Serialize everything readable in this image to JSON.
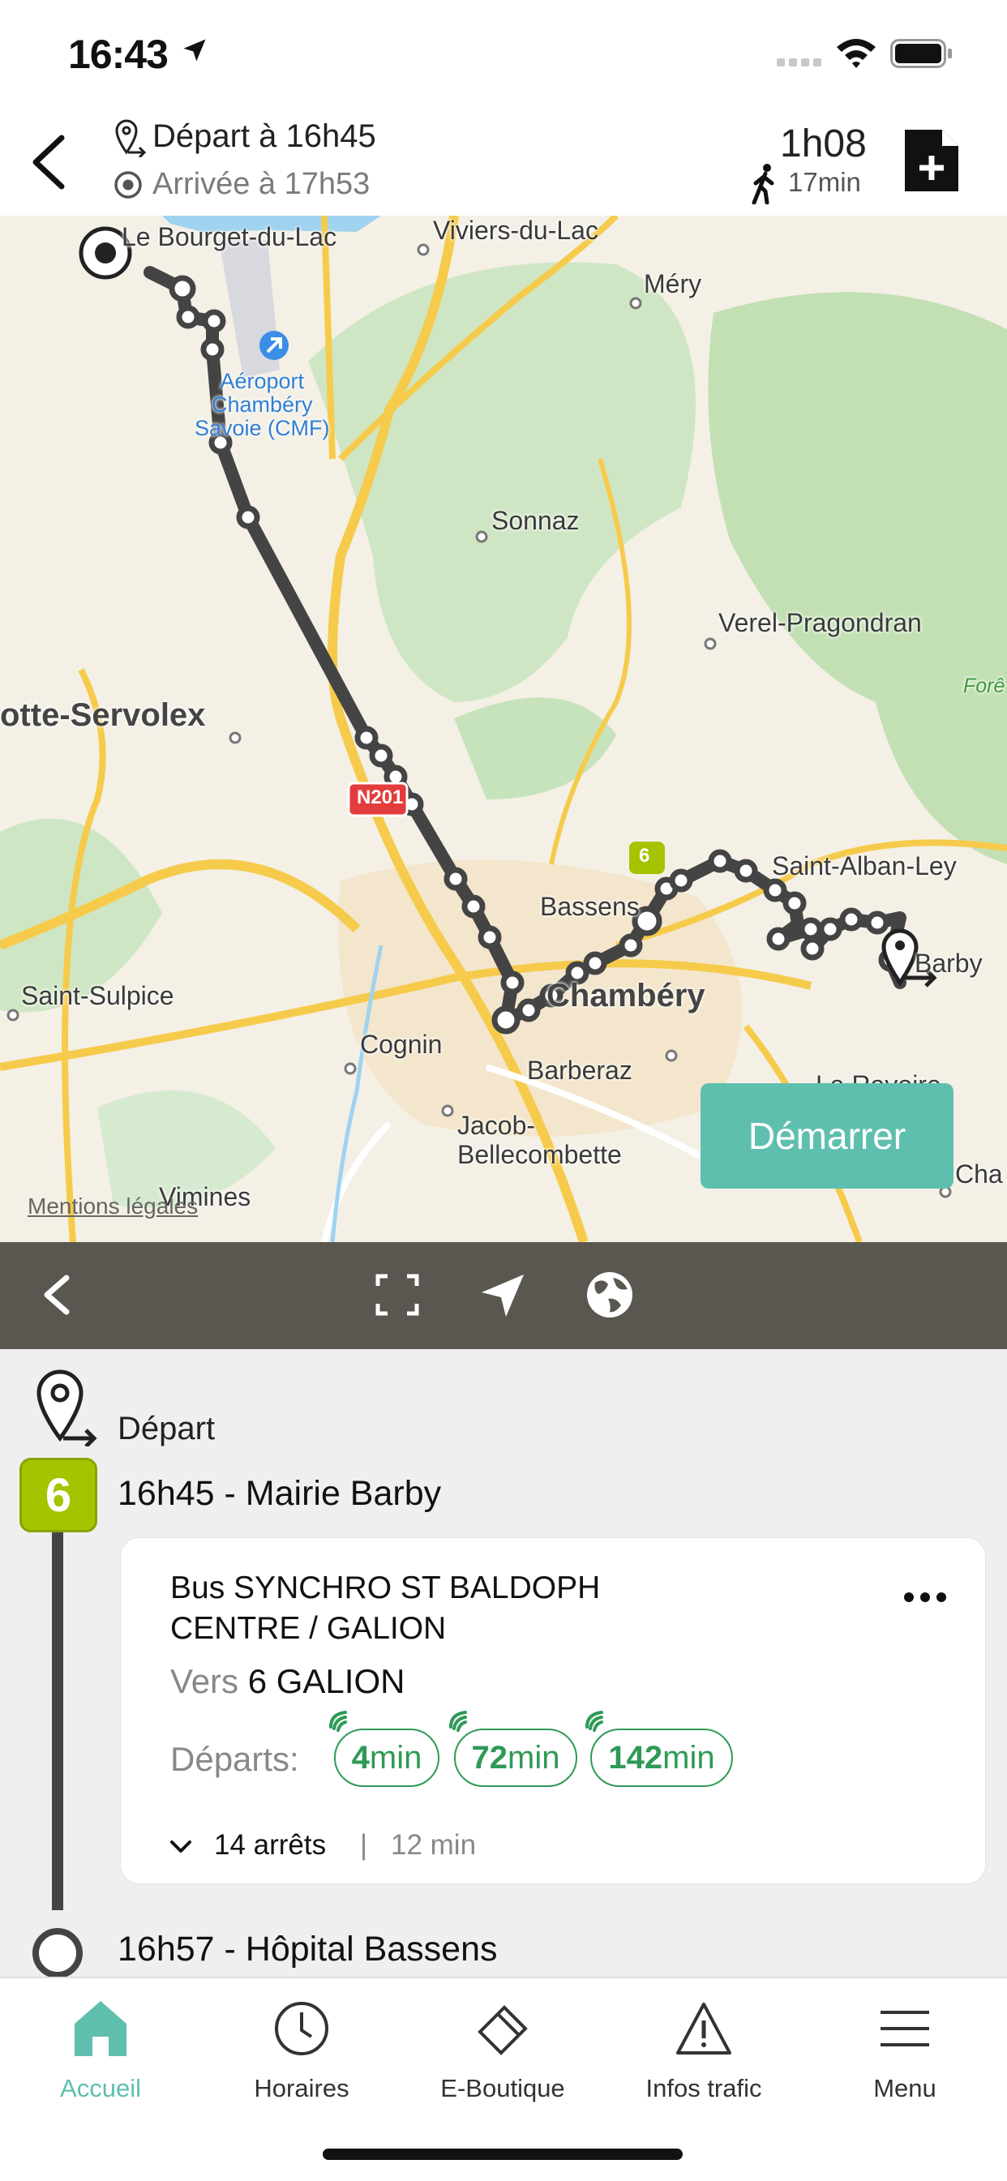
{
  "status_bar": {
    "time": "16:43"
  },
  "header": {
    "depart": "Départ à 16h45",
    "arrival": "Arrivée à 17h53",
    "duration": "1h08",
    "walk_time": "17min"
  },
  "map": {
    "labels": {
      "bourget": "Le Bourget-du-Lac",
      "viviers": "Viviers-du-Lac",
      "mery": "Méry",
      "aeroport": "Aéroport\nChambéry\nSavoie (CMF)",
      "sonnaz": "Sonnaz",
      "verel": "Verel-Pragondran",
      "motte": "otte-Servolex",
      "foret": "Forê",
      "n201": "N201",
      "saint_alban": "Saint-Alban-Ley",
      "bassens": "Bassens",
      "chambery": "Chambéry",
      "barby": "Barby",
      "saint_sulpice": "Saint-Sulpice",
      "cognin": "Cognin",
      "barberaz": "Barberaz",
      "jacob": "Jacob-\nBellecombette",
      "ravoire": "La Ravoire",
      "vimines": "Vimines",
      "cha": "Cha",
      "badge_6": "6"
    },
    "start_button": "Démarrer",
    "legal": "Mentions légales",
    "colors": {
      "route": "#444444",
      "start_button": "#5fbfae"
    }
  },
  "itinerary": {
    "depart_label": "Départ",
    "line_number": "6",
    "line_color": "#a6c300",
    "stop1": "16h45 - Mairie Barby",
    "bus_name": "Bus SYNCHRO ST BALDOPH CENTRE / GALION",
    "direction_prefix": "Vers",
    "direction": "6 GALION",
    "departs_label": "Départs:",
    "departures": [
      {
        "value": "4",
        "unit": "min"
      },
      {
        "value": "72",
        "unit": "min"
      },
      {
        "value": "142",
        "unit": "min"
      }
    ],
    "stops_count": "14 arrêts",
    "separator": "|",
    "stops_duration": "12 min",
    "stop2": "16h57 - Hôpital Bassens"
  },
  "tabs": [
    {
      "label": "Accueil",
      "icon": "home-icon",
      "active": true
    },
    {
      "label": "Horaires",
      "icon": "clock-icon",
      "active": false
    },
    {
      "label": "E-Boutique",
      "icon": "ticket-icon",
      "active": false
    },
    {
      "label": "Infos trafic",
      "icon": "warning-icon",
      "active": false
    },
    {
      "label": "Menu",
      "icon": "menu-icon",
      "active": false
    }
  ],
  "accent_color": "#5fbfae"
}
